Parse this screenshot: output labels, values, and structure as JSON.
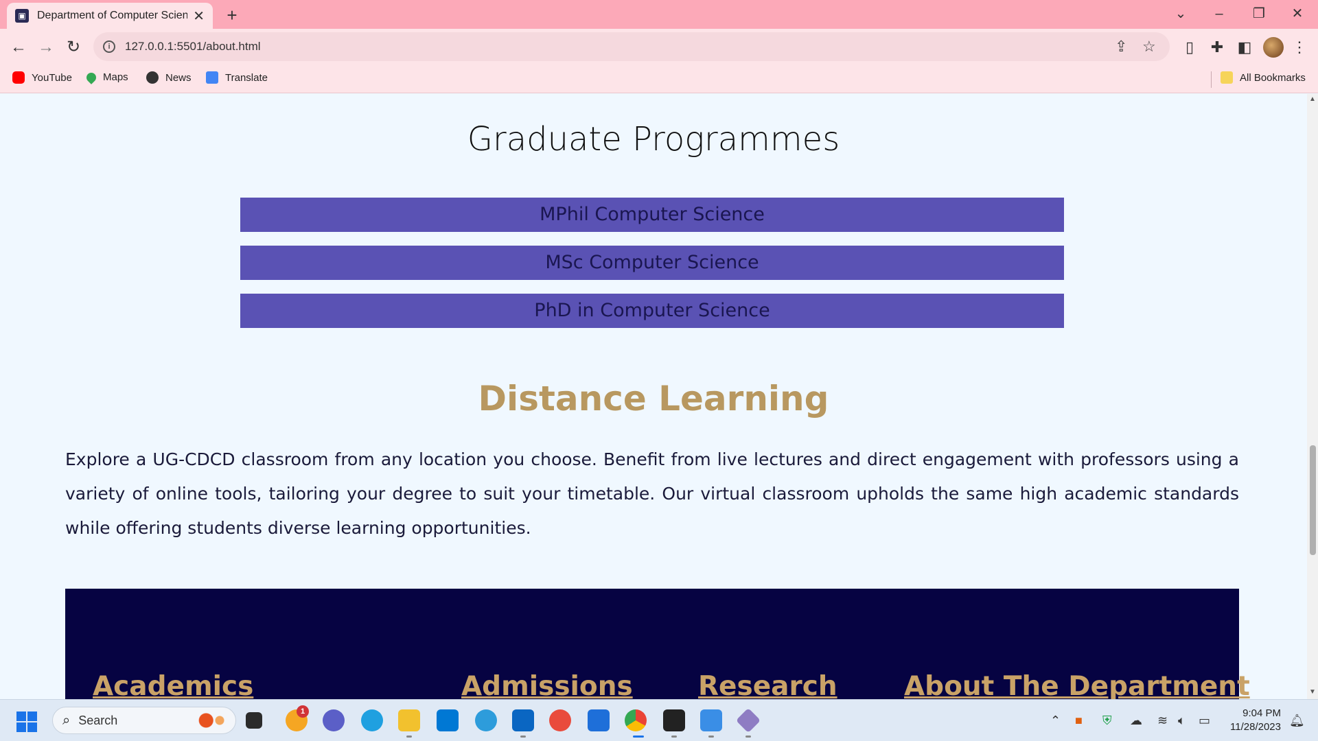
{
  "browser": {
    "tab_title": "Department of Computer Science",
    "tab_close": "✕",
    "new_tab": "+",
    "url": "127.0.0.1:5501/about.html",
    "bookmarks": [
      {
        "label": "YouTube",
        "icon": "youtube-icon",
        "color": "#ff0000"
      },
      {
        "label": "Maps",
        "icon": "maps-icon",
        "color": "#34a853"
      },
      {
        "label": "News",
        "icon": "news-icon",
        "color": "#333333"
      },
      {
        "label": "Translate",
        "icon": "translate-icon",
        "color": "#4285f4"
      }
    ],
    "all_bookmarks": "All Bookmarks"
  },
  "page": {
    "graduate_title": "Graduate Programmes",
    "programmes": [
      "MPhil Computer Science",
      "MSc Computer Science",
      "PhD in Computer Science"
    ],
    "distance_title": "Distance Learning",
    "distance_text": "Explore a UG-CDCD classroom from any location you choose. Benefit from live lectures and direct engagement with professors using a variety of online tools, tailoring your degree to suit your timetable. Our virtual classroom upholds the same high academic standards while offering students diverse learning opportunities.",
    "footer_links": [
      "Academics",
      "Admissions",
      "Research",
      "About The Department"
    ]
  },
  "taskbar": {
    "search_label": "Search",
    "notification_count": "1",
    "time": "9:04 PM",
    "date": "11/28/2023"
  },
  "colors": {
    "programme_button": "#5a52b4",
    "heading_gold": "#b89860",
    "footer_bg": "#060342",
    "tab_strip": "#fca9b8"
  }
}
